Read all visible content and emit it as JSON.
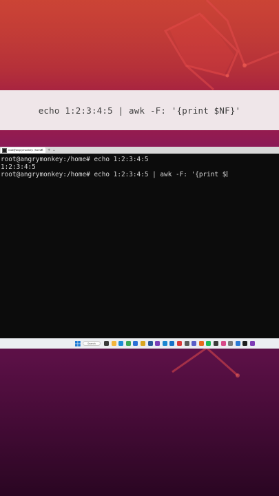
{
  "caption": {
    "text": "echo 1:2:3:4:5 | awk -F: '{print $NF}'"
  },
  "terminal_tab": {
    "title": "root@angrymonkey: /home",
    "close_glyph": "×",
    "new_tab_glyph": "+",
    "dropdown_glyph": "⌄"
  },
  "terminal": {
    "lines": [
      "root@angrymonkey:/home# echo 1:2:3:4:5",
      "1:2:3:4:5",
      "root@angrymonkey:/home# echo 1:2:3:4:5 | awk -F: '{print $"
    ]
  },
  "taskbar": {
    "search_placeholder": "Search",
    "icons": [
      {
        "name": "task-view-icon",
        "color": "#3a3a3a"
      },
      {
        "name": "file-explorer-icon",
        "color": "#f2b43c"
      },
      {
        "name": "edge-icon",
        "color": "#1c8bd6"
      },
      {
        "name": "chrome-icon",
        "color": "#3aa757"
      },
      {
        "name": "store-icon",
        "color": "#2b6fd6"
      },
      {
        "name": "photos-icon",
        "color": "#d9a520"
      },
      {
        "name": "word-icon",
        "color": "#2b579a"
      },
      {
        "name": "visual-studio-icon",
        "color": "#7b3fb8"
      },
      {
        "name": "vscode-icon",
        "color": "#1a86d0"
      },
      {
        "name": "mail-icon",
        "color": "#1870c6"
      },
      {
        "name": "app-red-icon",
        "color": "#d93a3a"
      },
      {
        "name": "settings-icon",
        "color": "#5a5a5a"
      },
      {
        "name": "teams-icon",
        "color": "#5b5fc7"
      },
      {
        "name": "firefox-icon",
        "color": "#e86a1c"
      },
      {
        "name": "spotify-icon",
        "color": "#1db954"
      },
      {
        "name": "app-dark-icon",
        "color": "#3b3b3b"
      },
      {
        "name": "app-pink-icon",
        "color": "#d64a8a"
      },
      {
        "name": "app-gray-icon",
        "color": "#7a7a7a"
      },
      {
        "name": "app-blue-icon",
        "color": "#2a7ad6"
      },
      {
        "name": "terminal-icon",
        "color": "#1e1e1e"
      },
      {
        "name": "app-purple-icon",
        "color": "#7e3bb5"
      }
    ]
  },
  "colors": {
    "terminal_bg": "#0c0c0c",
    "terminal_text": "#d8d8d8",
    "caption_bg": "#efe6e9"
  }
}
